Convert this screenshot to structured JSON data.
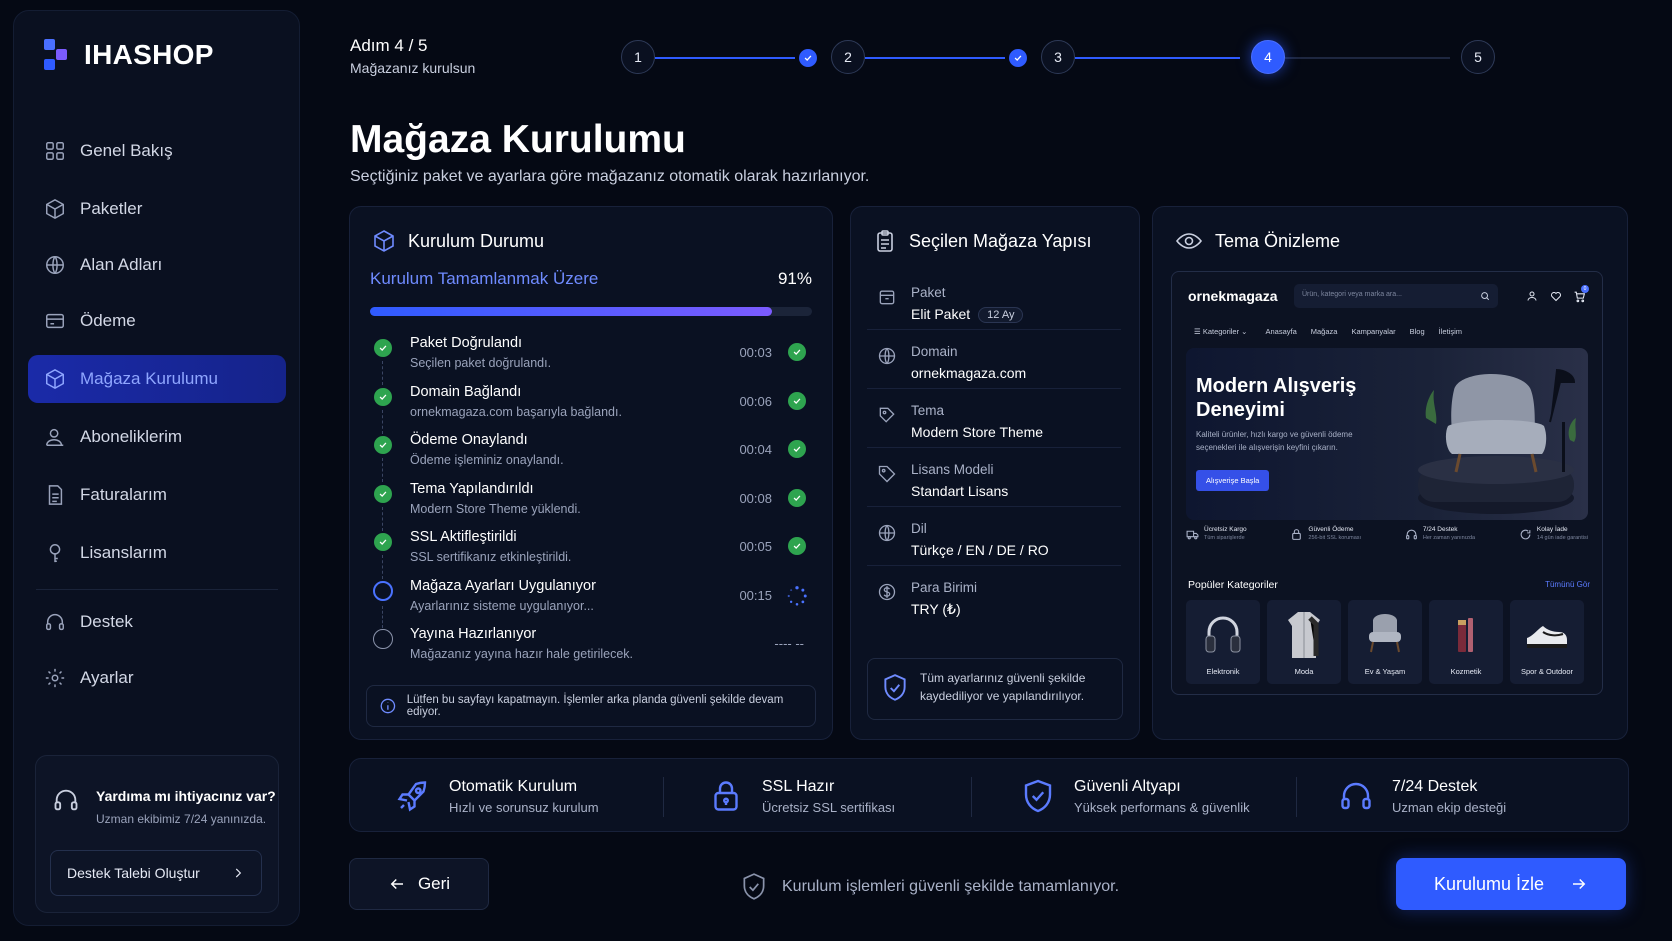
{
  "brand": {
    "name": "IHASHOP"
  },
  "sidebar": {
    "items": [
      {
        "label": "Genel Bakış",
        "icon": "grid-icon"
      },
      {
        "label": "Paketler",
        "icon": "box-icon"
      },
      {
        "label": "Alan Adları",
        "icon": "globe-icon"
      },
      {
        "label": "Ödeme",
        "icon": "credit-card-icon"
      },
      {
        "label": "Mağaza Kurulumu",
        "icon": "cube-icon",
        "active": true
      },
      {
        "label": "Aboneliklerim",
        "icon": "users-icon"
      },
      {
        "label": "Faturalarım",
        "icon": "document-icon"
      },
      {
        "label": "Lisanslarım",
        "icon": "key-icon"
      }
    ],
    "bottom_items": [
      {
        "label": "Destek",
        "icon": "headset-icon"
      },
      {
        "label": "Ayarlar",
        "icon": "gear-icon"
      }
    ],
    "help": {
      "title": "Yardıma mı ihtiyacınız var?",
      "subtitle": "Uzman ekibimiz 7/24 yanınızda.",
      "button": "Destek Talebi Oluştur"
    }
  },
  "stepper": {
    "label": "Adım 4 / 5",
    "sublabel": "Mağazanız kurulsun",
    "steps": [
      "1",
      "2",
      "3",
      "4",
      "5"
    ],
    "current": 4,
    "accent": "#2f5bff"
  },
  "page": {
    "title": "Mağaza Kurulumu",
    "description": "Seçtiğiniz paket ve ayarlara göre mağazanız otomatik olarak hazırlanıyor."
  },
  "install_status": {
    "title": "Kurulum Durumu",
    "progress_label": "Kurulum Tamamlanmak Üzere",
    "progress_text": "91%",
    "progress_value": 0.91,
    "tasks": [
      {
        "title": "Paket Doğrulandı",
        "subtitle": "Seçilen paket doğrulandı.",
        "time": "00:03",
        "status": "done"
      },
      {
        "title": "Domain Bağlandı",
        "subtitle": "ornekmagaza.com başarıyla bağlandı.",
        "time": "00:06",
        "status": "done"
      },
      {
        "title": "Ödeme Onaylandı",
        "subtitle": "Ödeme işleminiz onaylandı.",
        "time": "00:04",
        "status": "done"
      },
      {
        "title": "Tema Yapılandırıldı",
        "subtitle": "Modern Store Theme yüklendi.",
        "time": "00:08",
        "status": "done"
      },
      {
        "title": "SSL Aktifleştirildi",
        "subtitle": "SSL sertifikanız etkinleştirildi.",
        "time": "00:05",
        "status": "done"
      },
      {
        "title": "Mağaza Ayarları Uygulanıyor",
        "subtitle": "Ayarlarınız sisteme uygulanıyor...",
        "time": "00:15",
        "status": "running"
      },
      {
        "title": "Yayına Hazırlanıyor",
        "subtitle": "Mağazanız yayına hazır hale getirilecek.",
        "time": "---- --",
        "status": "waiting"
      }
    ],
    "notice": "Lütfen bu sayfayı kapatmayın. İşlemler arka planda güvenli şekilde devam ediyor."
  },
  "structure": {
    "title": "Seçilen Mağaza Yapısı",
    "items": [
      {
        "key": "Paket",
        "value": "Elit Paket",
        "badge": "12 Ay",
        "icon": "package-icon"
      },
      {
        "key": "Domain",
        "value": "ornekmagaza.com",
        "icon": "globe-icon"
      },
      {
        "key": "Tema",
        "value": "Modern Store Theme",
        "icon": "palette-icon"
      },
      {
        "key": "Lisans Modeli",
        "value": "Standart Lisans",
        "icon": "tag-icon"
      },
      {
        "key": "Dil",
        "value": "Türkçe / EN / DE / RO",
        "icon": "language-icon"
      },
      {
        "key": "Para Birimi",
        "value": "TRY (₺)",
        "icon": "currency-icon"
      }
    ],
    "secure_note": "Tüm ayarlarınız güvenli şekilde kaydediliyor ve yapılandırılıyor."
  },
  "preview": {
    "title": "Tema Önizleme",
    "site_name": "ornekmagaza",
    "search_placeholder": "Ürün, kategori veya marka ara...",
    "nav": [
      "Kategoriler",
      "Anasayfa",
      "Mağaza",
      "Kampanyalar",
      "Blog",
      "İletişim"
    ],
    "hero_title": "Modern Alışveriş Deneyimi",
    "hero_text": "Kaliteli ürünler, hızlı kargo ve güvenli ödeme seçenekleri ile alışverişin keyfini çıkarın.",
    "hero_button": "Alışverişe Başla",
    "cart_count": "0",
    "features": [
      {
        "title": "Ücretsiz Kargo",
        "sub": "Tüm siparişlerde"
      },
      {
        "title": "Güvenli Ödeme",
        "sub": "256-bit SSL koruması"
      },
      {
        "title": "7/24 Destek",
        "sub": "Her zaman yanınızda"
      },
      {
        "title": "Kolay İade",
        "sub": "14 gün iade garantisi"
      }
    ],
    "categories_title": "Popüler Kategoriler",
    "categories_all": "Tümünü Gör",
    "categories": [
      "Elektronik",
      "Moda",
      "Ev & Yaşam",
      "Kozmetik",
      "Spor & Outdoor"
    ]
  },
  "features": [
    {
      "title": "Otomatik Kurulum",
      "sub": "Hızlı ve sorunsuz kurulum",
      "icon": "rocket-icon"
    },
    {
      "title": "SSL Hazır",
      "sub": "Ücretsiz SSL sertifikası",
      "icon": "lock-icon"
    },
    {
      "title": "Güvenli Altyapı",
      "sub": "Yüksek performans & güvenlik",
      "icon": "shield-icon"
    },
    {
      "title": "7/24 Destek",
      "sub": "Uzman ekip desteği",
      "icon": "headset-icon"
    }
  ],
  "footer": {
    "back": "Geri",
    "note": "Kurulum işlemleri güvenli şekilde tamamlanıyor.",
    "primary": "Kurulumu İzle"
  }
}
